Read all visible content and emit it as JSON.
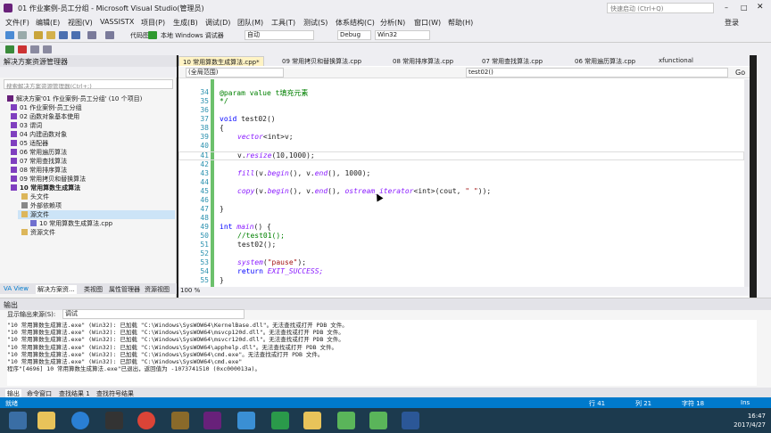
{
  "window": {
    "title": "01 作业案例-员工分组 - Microsoft Visual Studio(管理员)",
    "quick_launch": "快速启动 (Ctrl+Q)",
    "login": "登录"
  },
  "menu": [
    "文件(F)",
    "编辑(E)",
    "视图(V)",
    "VASSISTX",
    "项目(P)",
    "生成(B)",
    "调试(D)",
    "团队(M)",
    "工具(T)",
    "测试(S)",
    "体系结构(C)",
    "分析(N)",
    "窗口(W)",
    "帮助(H)"
  ],
  "toolbar": {
    "local_debugger": "本地 Windows 调试器",
    "auto": "自动",
    "config": "Debug",
    "platform": "Win32",
    "code_map": "代码图"
  },
  "solution": {
    "title": "解决方案资源管理器",
    "search_placeholder": "搜索解决方案资源管理器(Ctrl+;)",
    "items": [
      "解决方案'01 作业案例-员工分组' (10 个项目)",
      "01 作业案例-员工分组",
      "02 函数对象基本使用",
      "03 谓词",
      "04 内建函数对象",
      "05 适配器",
      "06 常用遍历算法",
      "07 常用查找算法",
      "08 常用排序算法",
      "09 常用拷贝和替换算法",
      "10 常用算数生成算法",
      "头文件",
      "外部依赖项",
      "源文件",
      "10 常用算数生成算法.cpp",
      "资源文件"
    ],
    "bottom_tabs": [
      "VA View",
      "解决方案资...",
      "类视图",
      "属性管理器",
      "资源视图"
    ]
  },
  "editor": {
    "tabs": [
      "10 常用算数生成算法.cpp*",
      "09 常用拷贝和替换算法.cpp",
      "08 常用排序算法.cpp",
      "07 常用查找算法.cpp",
      "06 常用遍历算法.cpp",
      "xfunctional"
    ],
    "scope": "(全局范围)",
    "function": "test02()",
    "go": "Go",
    "zoom": "100 %",
    "line_numbers": [
      "34",
      "35",
      "36",
      "37",
      "38",
      "39",
      "40",
      "41",
      "42",
      "43",
      "44",
      "45",
      "46",
      "47",
      "48",
      "49",
      "50",
      "51",
      "52",
      "53",
      "54",
      "55"
    ],
    "lines": {
      "l34a": "@param value t",
      "l34b": "填充元素",
      "l35": "*/",
      "l37a": "void",
      "l37b": " test02()",
      "l38": "{",
      "l39a": "vector",
      "l39b": "<int>v;",
      "l41a": "v.",
      "l41b": "resize",
      "l41c": "(10,1000);",
      "l43a": "fill",
      "l43b": "(v.",
      "l43c": "begin",
      "l43d": "(), v.",
      "l43e": "end",
      "l43f": "(), 1000);",
      "l45a": "copy",
      "l45b": "(v.",
      "l45c": "begin",
      "l45d": "(), v.",
      "l45e": "end",
      "l45f": "(), ",
      "l45g": "ostream_iterator",
      "l45h": "<int>(cout, ",
      "l45i": "\" \"",
      "l45j": "));",
      "l47": "}",
      "l49a": "int",
      "l49b": " main",
      "l49c": "() {",
      "l50": "//test01();",
      "l51": "test02();",
      "l53a": "system",
      "l53b": "(",
      "l53c": "\"pause\"",
      "l53d": ");",
      "l54a": "return",
      "l54b": " EXIT_SUCCESS;",
      "l55": "}"
    }
  },
  "output": {
    "title": "输出",
    "source_label": "显示输出来源(S):",
    "source_value": "调试",
    "lines": [
      "\"10 常用算数生成算法.exe\" (Win32): 已加载 \"C:\\Windows\\SysWOW64\\KernelBase.dll\"。无法查找或打开 PDB 文件。",
      "\"10 常用算数生成算法.exe\" (Win32): 已加载 \"C:\\Windows\\SysWOW64\\msvcp120d.dll\"。无法查找或打开 PDB 文件。",
      "\"10 常用算数生成算法.exe\" (Win32): 已加载 \"C:\\Windows\\SysWOW64\\msvcr120d.dll\"。无法查找或打开 PDB 文件。",
      "\"10 常用算数生成算法.exe\" (Win32): 已加载 \"C:\\Windows\\SysWOW64\\apphelp.dll\"。无法查找或打开 PDB 文件。",
      "\"10 常用算数生成算法.exe\" (Win32): 已加载 \"C:\\Windows\\SysWOW64\\cmd.exe\"。无法查找或打开 PDB 文件。",
      "\"10 常用算数生成算法.exe\" (Win32): 已卸载 \"C:\\Windows\\SysWOW64\\cmd.exe\"",
      "程序\"[4696] 10 常用算数生成算法.exe\"已退出，返回值为 -1073741510 (0xc000013a)。"
    ],
    "tabs": [
      "输出",
      "命令窗口",
      "查找结果 1",
      "查找符号结果"
    ]
  },
  "status": {
    "ready": "就绪",
    "line": "行 41",
    "col": "列 21",
    "char": "字符 18",
    "mode": "Ins"
  },
  "clock": {
    "time": "16:47",
    "date": "2017/4/27"
  },
  "colors": {
    "accent": "#007acc",
    "vs_purple": "#68217a",
    "taskbar": "#1c3a4e"
  }
}
